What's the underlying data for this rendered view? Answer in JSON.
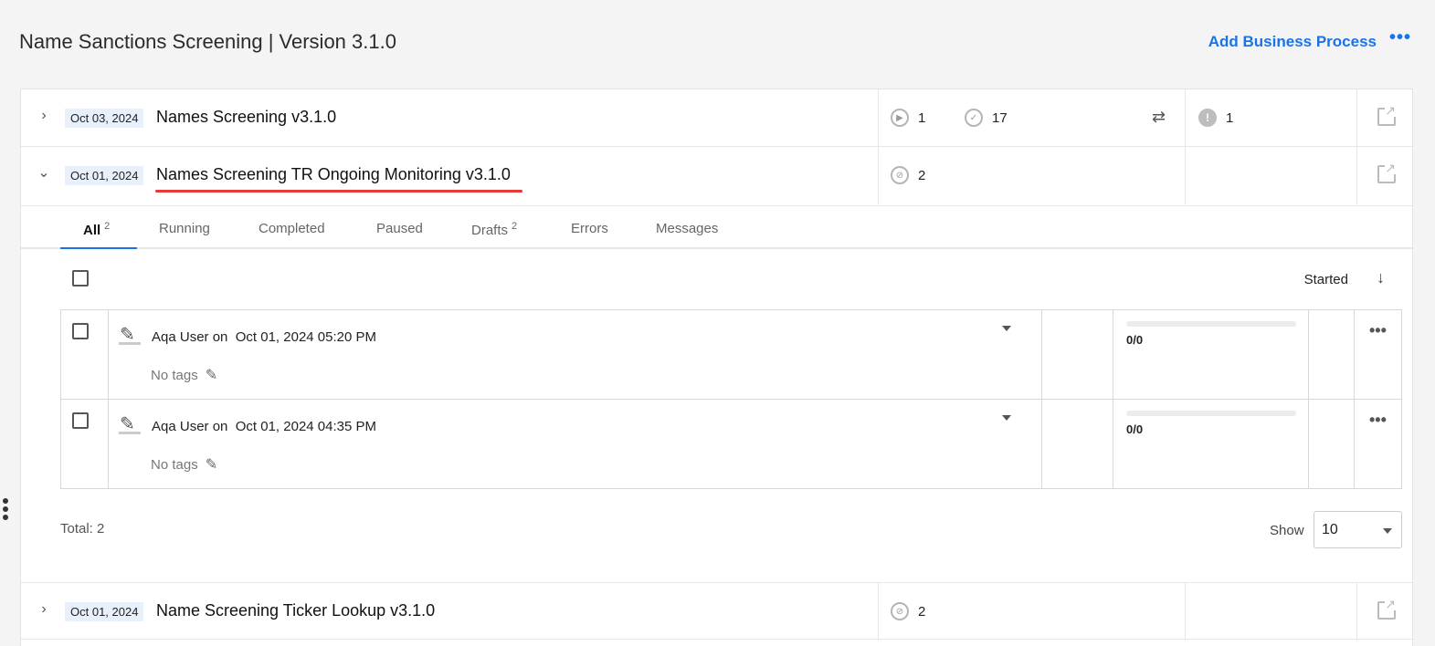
{
  "header": {
    "title": "Name Sanctions Screening | Version 3.1.0",
    "add_business_process": "Add Business Process",
    "more": "•••"
  },
  "processes": [
    {
      "date": "Oct 03, 2024",
      "name": "Names Screening v3.1.0",
      "expanded": false,
      "running_count": "1",
      "completed_count": "17",
      "error_count": "1"
    },
    {
      "date": "Oct 01, 2024",
      "name": "Names Screening TR Ongoing Monitoring v3.1.0",
      "expanded": true,
      "drafts_count": "2"
    },
    {
      "date": "Oct 01, 2024",
      "name": "Name Screening Ticker Lookup v3.1.0",
      "expanded": false,
      "drafts_count": "2"
    }
  ],
  "tabs": [
    {
      "label": "All",
      "count": "2"
    },
    {
      "label": "Running",
      "count": ""
    },
    {
      "label": "Completed",
      "count": ""
    },
    {
      "label": "Paused",
      "count": ""
    },
    {
      "label": "Drafts",
      "count": "2"
    },
    {
      "label": "Errors",
      "count": ""
    },
    {
      "label": "Messages",
      "count": ""
    }
  ],
  "sort": {
    "label": "Started",
    "arrow": "↓"
  },
  "instances": [
    {
      "author_prefix": "Aqa User on",
      "timestamp": "Oct 01, 2024 05:20 PM",
      "tags": "No tags",
      "progress": "0/0",
      "progress_fraction": 0
    },
    {
      "author_prefix": "Aqa User on",
      "timestamp": "Oct 01, 2024 04:35 PM",
      "tags": "No tags",
      "progress": "0/0",
      "progress_fraction": 0
    }
  ],
  "footer": {
    "total": "Total: 2",
    "show_label": "Show",
    "show_value": "10"
  },
  "icons": {
    "chevron_right": "›",
    "chevron_down": "⌄",
    "pencil": "✎",
    "more": "•••",
    "play": "▶",
    "check": "✓",
    "exclamation": "!",
    "draft": "⊘",
    "swap": "⇄"
  },
  "colors": {
    "accent": "#1a73e8",
    "highlight_underline": "#e53935",
    "date_badge_bg": "#e7f0fb"
  }
}
